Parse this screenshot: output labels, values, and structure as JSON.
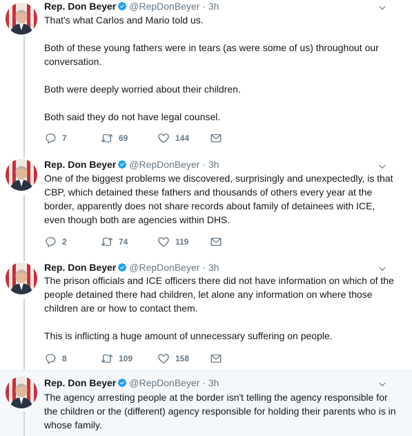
{
  "tweets": [
    {
      "name": "Rep. Don Beyer",
      "handle": "@RepDonBeyer",
      "time": "3h",
      "text": "That's what Carlos and Mario told us.\n\nBoth of these young fathers were in tears (as were some of us) throughout our conversation.\n\nBoth were deeply worried about their children.\n\nBoth said they do not have legal counsel.",
      "replies": "7",
      "retweets": "69",
      "likes": "144"
    },
    {
      "name": "Rep. Don Beyer",
      "handle": "@RepDonBeyer",
      "time": "3h",
      "text": "One of the biggest problems we discovered, surprisingly and unexpectedly, is that CBP, which detained these fathers and thousands of others every year at the border, apparently does not share records about family of detainees with ICE, even though both are agencies within DHS.",
      "replies": "2",
      "retweets": "74",
      "likes": "119"
    },
    {
      "name": "Rep. Don Beyer",
      "handle": "@RepDonBeyer",
      "time": "3h",
      "text": "The prison officials and ICE officers there did not have information on which of the people detained there had children, let alone any information on where those children are or how to contact them.\n\nThis is inflicting a huge amount of unnecessary suffering on people.",
      "replies": "8",
      "retweets": "109",
      "likes": "158"
    },
    {
      "name": "Rep. Don Beyer",
      "handle": "@RepDonBeyer",
      "time": "3h",
      "text": "The agency arresting people at the border isn't telling the agency responsible for the children or the (different) agency responsible for holding their parents who is in whose family."
    }
  ],
  "separator": "·",
  "colors": {
    "verified": "#1da1f2",
    "muted": "#657786",
    "thread_line": "#ccd6dd",
    "highlight_bg": "#f5f8fa"
  },
  "icons": {
    "reply": "reply-icon",
    "retweet": "retweet-icon",
    "like": "heart-icon",
    "dm": "envelope-icon",
    "menu": "chevron-down-icon",
    "badge": "verified-badge-icon"
  }
}
